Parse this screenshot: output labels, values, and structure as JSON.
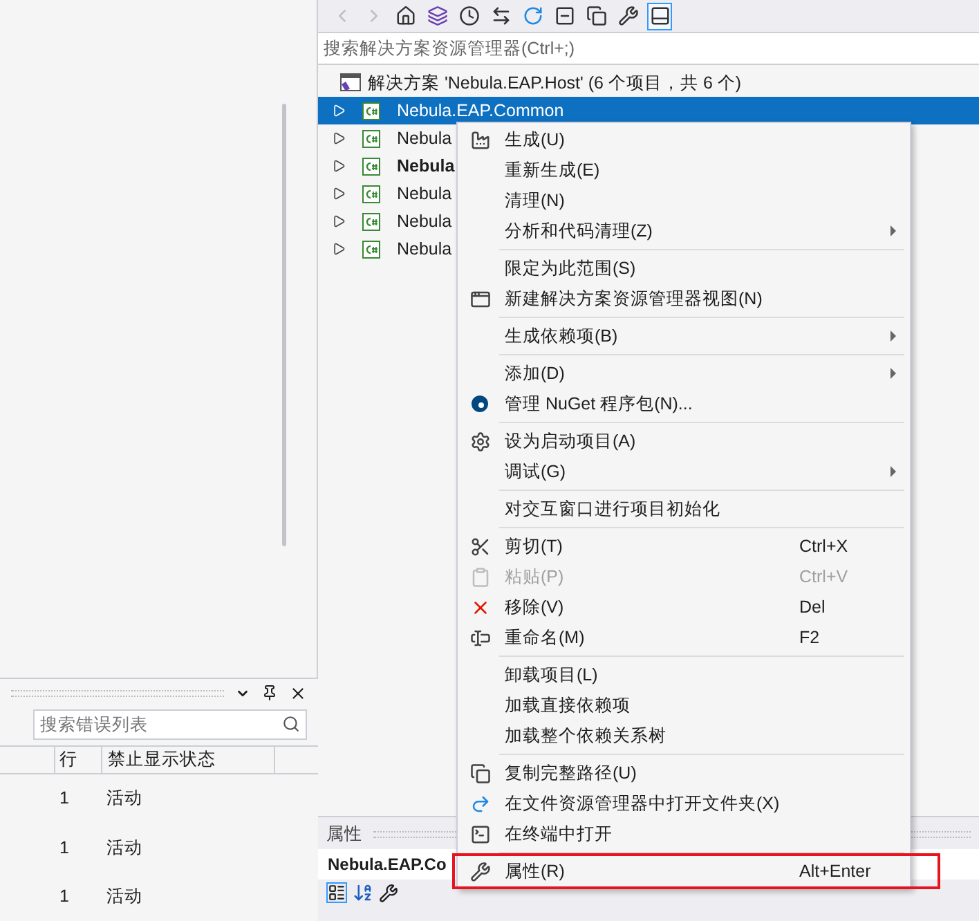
{
  "solution_explorer": {
    "toolbar": [
      {
        "kind": "back",
        "disabled": true
      },
      {
        "kind": "forward",
        "disabled": true
      },
      {
        "kind": "home",
        "disabled": false
      },
      {
        "kind": "views",
        "disabled": false
      },
      {
        "kind": "history",
        "disabled": false
      },
      {
        "kind": "sync",
        "disabled": false
      },
      {
        "kind": "refresh",
        "disabled": false
      },
      {
        "kind": "collapse",
        "disabled": false
      },
      {
        "kind": "copy",
        "disabled": false
      },
      {
        "kind": "properties",
        "disabled": false
      },
      {
        "kind": "preview",
        "disabled": false,
        "selected": true
      }
    ],
    "search": {
      "placeholder": "搜索解决方案资源管理器(Ctrl+;)"
    },
    "solution": "解决方案 'Nebula.EAP.Host' (6 个项目，共 6 个)",
    "projects": [
      {
        "name": "Nebula.EAP.Common",
        "selected": true,
        "bold": false
      },
      {
        "name": "Nebula",
        "selected": false,
        "bold": false
      },
      {
        "name": "Nebula",
        "selected": false,
        "bold": true
      },
      {
        "name": "Nebula",
        "selected": false,
        "bold": false
      },
      {
        "name": "Nebula",
        "selected": false,
        "bold": false
      },
      {
        "name": "Nebula",
        "selected": false,
        "bold": false
      }
    ]
  },
  "error_list": {
    "search": {
      "placeholder": "搜索错误列表"
    },
    "columns": [
      "行",
      "禁止显示状态"
    ],
    "rows": [
      {
        "line": "1",
        "state": "活动"
      },
      {
        "line": "1",
        "state": "活动"
      },
      {
        "line": "1",
        "state": "活动"
      }
    ]
  },
  "properties": {
    "title": "属性",
    "object": "Nebula.EAP.Co"
  },
  "context_menu": [
    [
      {
        "label": "生成(U)",
        "kind": "build"
      },
      {
        "label": "重新生成(E)",
        "kind": "plain"
      },
      {
        "label": "清理(N)",
        "kind": "plain"
      },
      {
        "label": "分析和代码清理(Z)",
        "kind": "plain",
        "submenu": true
      }
    ],
    [
      {
        "label": "限定为此范围(S)",
        "kind": "plain"
      },
      {
        "label": "新建解决方案资源管理器视图(N)",
        "kind": "view"
      }
    ],
    [
      {
        "label": "生成依赖项(B)",
        "kind": "plain",
        "submenu": true
      }
    ],
    [
      {
        "label": "添加(D)",
        "kind": "plain",
        "submenu": true
      },
      {
        "label": "管理 NuGet 程序包(N)...",
        "kind": "nuget"
      }
    ],
    [
      {
        "label": "设为启动项目(A)",
        "kind": "startup"
      },
      {
        "label": "调试(G)",
        "kind": "plain",
        "submenu": true
      }
    ],
    [
      {
        "label": "对交互窗口进行项目初始化",
        "kind": "plain"
      }
    ],
    [
      {
        "label": "剪切(T)",
        "kind": "cut",
        "shortcut": "Ctrl+X"
      },
      {
        "label": "粘贴(P)",
        "kind": "paste",
        "shortcut": "Ctrl+V",
        "disabled": true
      },
      {
        "label": "移除(V)",
        "kind": "remove",
        "shortcut": "Del"
      },
      {
        "label": "重命名(M)",
        "kind": "rename",
        "shortcut": "F2"
      }
    ],
    [
      {
        "label": "卸载项目(L)",
        "kind": "plain"
      },
      {
        "label": "加载直接依赖项",
        "kind": "plain"
      },
      {
        "label": "加载整个依赖关系树",
        "kind": "plain"
      }
    ],
    [
      {
        "label": "复制完整路径(U)",
        "kind": "copy"
      },
      {
        "label": "在文件资源管理器中打开文件夹(X)",
        "kind": "explorer"
      },
      {
        "label": "在终端中打开",
        "kind": "terminal"
      }
    ],
    [
      {
        "label": "属性(R)",
        "kind": "properties",
        "shortcut": "Alt+Enter",
        "highlighted": true
      }
    ]
  ]
}
